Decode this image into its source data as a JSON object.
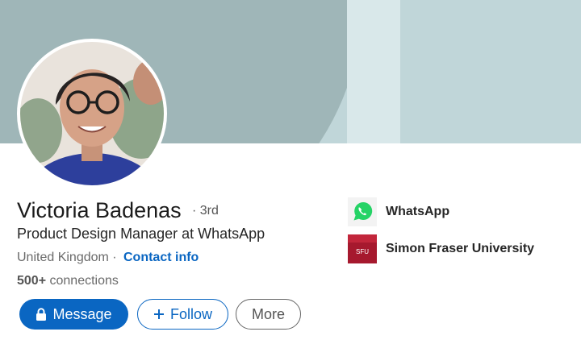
{
  "profile": {
    "name": "Victoria Badenas",
    "degree": "· 3rd",
    "headline": "Product Design Manager at WhatsApp",
    "location": "United Kingdom",
    "location_separator": " ·",
    "contact_info": "Contact info",
    "connections_count": "500+",
    "connections_label": "connections"
  },
  "actions": {
    "message": "Message",
    "follow": "Follow",
    "more": "More"
  },
  "experience": [
    {
      "label": "WhatsApp",
      "icon": "whatsapp-logo-icon"
    },
    {
      "label": "Simon Fraser University",
      "icon": "sfu-logo-icon",
      "logo_text": "SFU"
    }
  ],
  "colors": {
    "accent": "#0a66c2",
    "banner": "#c0d6d9",
    "banner_arc": "#9fb6b8",
    "whatsapp": "#25d366",
    "sfu": "#a6192e"
  }
}
